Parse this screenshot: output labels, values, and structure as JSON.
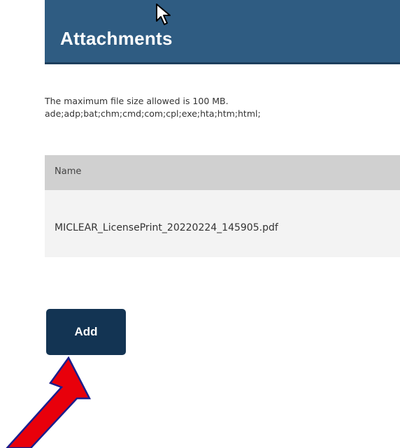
{
  "attachments": {
    "title": "Attachments",
    "max_size_text": "The maximum file size allowed is 100 MB.",
    "blocked_extensions": "ade;adp;bat;chm;cmd;com;cpl;exe;hta;htm;html;"
  },
  "table": {
    "columns": [
      "Name"
    ],
    "rows": [
      {
        "name": "MICLEAR_LicensePrint_20220224_145905.pdf"
      }
    ]
  },
  "actions": {
    "add_label": "Add"
  },
  "colors": {
    "header_bg": "#2f5c82",
    "button_bg": "#133453",
    "table_header_bg": "#d0d0d0",
    "row_bg": "#f3f3f3",
    "annotation_arrow": "#e8000b"
  },
  "icons": [
    "mouse-pointer-icon",
    "red-arrow-annotation"
  ]
}
